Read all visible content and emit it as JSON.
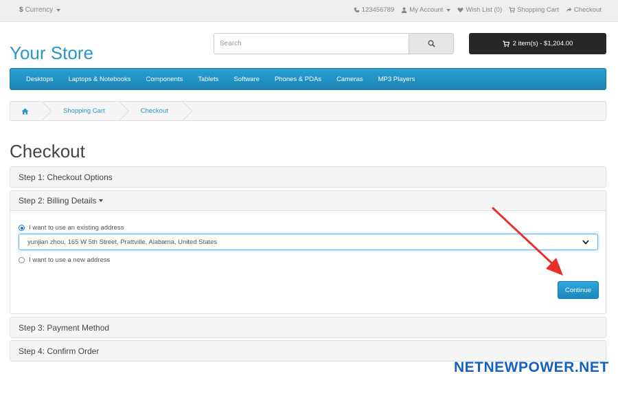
{
  "topbar": {
    "currency_symbol": "$",
    "currency_label": "Currency",
    "phone": "123456789",
    "my_account": "My Account",
    "wish_list": "Wish List (0)",
    "shopping_cart": "Shopping Cart",
    "checkout": "Checkout"
  },
  "header": {
    "logo": "Your Store",
    "search_placeholder": "Search",
    "cart_summary": "2 item(s) - $1,204.00"
  },
  "nav": {
    "items": [
      "Desktops",
      "Laptops & Notebooks",
      "Components",
      "Tablets",
      "Software",
      "Phones & PDAs",
      "Cameras",
      "MP3 Players"
    ]
  },
  "breadcrumb": {
    "items": [
      "Shopping Cart",
      "Checkout"
    ]
  },
  "page": {
    "title": "Checkout",
    "step1": "Step 1: Checkout Options",
    "step2": "Step 2: Billing Details",
    "step3": "Step 3: Payment Method",
    "step4": "Step 4: Confirm Order",
    "existing_address_label": "I want to use an existing address",
    "selected_address": "yunjian zhou, 165 W 5th Street, Prattville, Alabama, United States",
    "new_address_label": "I want to use a new address",
    "continue_label": "Continue"
  },
  "watermark": "NETNEWPOWER.NET",
  "colors": {
    "brand_blue": "#2a95c8",
    "cart_dark": "#272727",
    "annotation_red": "#e8302a",
    "watermark_blue": "#1560c6"
  }
}
